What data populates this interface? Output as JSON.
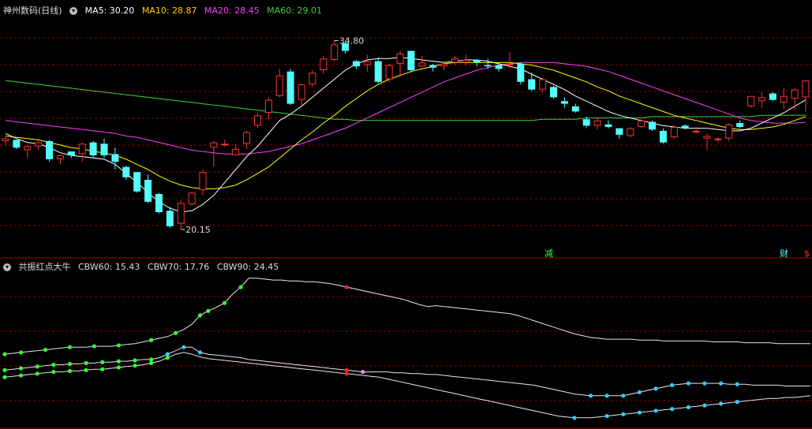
{
  "main_header": {
    "title": "神州数码(日线)",
    "indicators": [
      {
        "label": "MA5: 30.20",
        "color": "#ffffff"
      },
      {
        "label": "MA10: 28.87",
        "color": "#ffd000"
      },
      {
        "label": "MA20: 28.45",
        "color": "#ff40ff"
      },
      {
        "label": "MA60: 29.01",
        "color": "#40d040"
      }
    ]
  },
  "sub_header": {
    "title": "共振红点大牛",
    "indicators": [
      {
        "label": "CBW60: 15.43",
        "color": "#ffffff"
      },
      {
        "label": "CBW70: 17.76",
        "color": "#ffffff"
      },
      {
        "label": "CBW90: 24.45",
        "color": "#ffffff"
      }
    ]
  },
  "markers": {
    "jian": "减",
    "cai": "财",
    "dollar": "$"
  },
  "colors": {
    "up": "#ff3232",
    "down": "#54ffff",
    "grid": "#8b0000",
    "ma5": "#ffffff",
    "ma10": "#ffff00",
    "ma20": "#ff40ff",
    "ma60": "#40d040"
  },
  "chart_data": [
    {
      "type": "candlestick",
      "title": "神州数码(日线)",
      "ylim": [
        18.5,
        36.6
      ],
      "high_label": "34.80",
      "low_label": "20.15",
      "candles": [
        [
          27.0,
          27.3,
          26.7,
          27.2
        ],
        [
          27.1,
          27.1,
          26.4,
          26.5
        ],
        [
          26.3,
          26.7,
          25.7,
          26.6
        ],
        [
          26.6,
          27.0,
          26.3,
          26.9
        ],
        [
          27.0,
          27.1,
          25.4,
          25.6
        ],
        [
          25.6,
          25.9,
          25.2,
          25.9
        ],
        [
          26.2,
          26.2,
          25.7,
          25.9
        ],
        [
          26.0,
          26.9,
          25.4,
          26.8
        ],
        [
          26.9,
          27.0,
          25.7,
          25.9
        ],
        [
          26.8,
          27.2,
          25.7,
          25.9
        ],
        [
          26.0,
          26.5,
          24.8,
          25.4
        ],
        [
          25.0,
          25.1,
          24.0,
          24.2
        ],
        [
          24.6,
          24.6,
          23.0,
          23.1
        ],
        [
          24.0,
          24.4,
          22.2,
          22.3
        ],
        [
          22.9,
          23.0,
          21.4,
          21.5
        ],
        [
          21.6,
          21.9,
          20.3,
          20.4
        ],
        [
          20.6,
          22.4,
          20.15,
          22.2
        ],
        [
          22.1,
          23.1,
          22.0,
          23.0
        ],
        [
          23.2,
          24.8,
          22.8,
          24.6
        ],
        [
          26.5,
          27.0,
          25.0,
          26.9
        ],
        [
          26.8,
          27.1,
          26.6,
          26.8
        ],
        [
          25.9,
          26.8,
          25.9,
          26.4
        ],
        [
          26.8,
          27.8,
          26.4,
          27.7
        ],
        [
          28.2,
          29.2,
          28.0,
          29.0
        ],
        [
          29.2,
          30.4,
          28.7,
          30.2
        ],
        [
          30.5,
          32.6,
          30.4,
          32.1
        ],
        [
          32.4,
          32.6,
          29.8,
          29.9
        ],
        [
          30.2,
          31.5,
          29.8,
          31.4
        ],
        [
          31.4,
          32.5,
          31.2,
          32.3
        ],
        [
          32.5,
          33.6,
          32.2,
          33.4
        ],
        [
          33.3,
          34.8,
          33.2,
          34.5
        ],
        [
          34.6,
          34.7,
          33.8,
          34.0
        ],
        [
          33.2,
          33.3,
          32.6,
          32.8
        ],
        [
          32.9,
          33.7,
          32.4,
          33.2
        ],
        [
          33.2,
          33.5,
          31.5,
          31.6
        ],
        [
          31.8,
          33.0,
          31.6,
          32.9
        ],
        [
          33.0,
          34.0,
          32.0,
          33.8
        ],
        [
          34.0,
          34.0,
          32.3,
          32.5
        ],
        [
          32.8,
          33.6,
          32.8,
          33.1
        ],
        [
          32.9,
          33.0,
          32.4,
          32.7
        ],
        [
          32.8,
          33.2,
          32.5,
          33.0
        ],
        [
          33.1,
          33.6,
          32.9,
          33.4
        ],
        [
          33.1,
          33.7,
          32.9,
          33.3
        ],
        [
          33.3,
          33.3,
          32.8,
          33.1
        ],
        [
          32.9,
          33.4,
          32.6,
          32.8
        ],
        [
          32.9,
          32.9,
          32.4,
          32.6
        ],
        [
          32.9,
          33.9,
          32.6,
          33.0
        ],
        [
          33.0,
          33.1,
          31.4,
          31.6
        ],
        [
          31.8,
          32.3,
          30.9,
          31.0
        ],
        [
          31.0,
          31.9,
          30.8,
          31.8
        ],
        [
          31.2,
          31.3,
          30.3,
          30.4
        ],
        [
          30.1,
          30.4,
          29.6,
          29.9
        ],
        [
          29.7,
          29.9,
          29.2,
          29.3
        ],
        [
          28.7,
          28.9,
          28.0,
          28.2
        ],
        [
          28.2,
          28.8,
          27.9,
          28.6
        ],
        [
          28.3,
          28.6,
          28.0,
          28.1
        ],
        [
          28.0,
          28.0,
          27.2,
          27.5
        ],
        [
          27.4,
          28.1,
          27.3,
          28.0
        ],
        [
          28.1,
          28.7,
          28.0,
          28.6
        ],
        [
          28.5,
          28.6,
          27.8,
          27.9
        ],
        [
          27.8,
          28.0,
          26.8,
          26.9
        ],
        [
          27.3,
          28.2,
          27.2,
          28.1
        ],
        [
          28.2,
          28.3,
          27.9,
          28.0
        ],
        [
          27.8,
          28.1,
          27.6,
          27.8
        ],
        [
          27.2,
          27.6,
          26.3,
          27.4
        ],
        [
          27.1,
          27.3,
          26.9,
          27.2
        ],
        [
          27.2,
          28.4,
          27.0,
          28.3
        ],
        [
          28.4,
          28.6,
          28.0,
          28.1
        ],
        [
          29.7,
          30.5,
          29.6,
          30.5
        ],
        [
          30.1,
          30.8,
          29.6,
          30.4
        ],
        [
          30.7,
          30.8,
          30.1,
          30.2
        ],
        [
          30.0,
          31.1,
          29.5,
          30.5
        ],
        [
          30.3,
          31.1,
          29.4,
          31.0
        ],
        [
          30.4,
          31.7,
          29.3,
          31.7
        ]
      ],
      "ma": {
        "MA5": [
          27.6,
          27.2,
          26.9,
          26.8,
          26.5,
          26.1,
          25.9,
          25.8,
          25.7,
          25.6,
          25.2,
          24.5,
          23.8,
          23.0,
          22.3,
          21.8,
          21.5,
          21.6,
          22.1,
          22.8,
          23.8,
          24.8,
          25.8,
          26.6,
          27.6,
          28.6,
          29.1,
          29.7,
          30.4,
          31.1,
          31.8,
          32.5,
          33.0,
          33.3,
          33.4,
          33.4,
          33.5,
          33.4,
          33.3,
          33.2,
          33.1,
          33.2,
          33.3,
          33.3,
          33.2,
          33.0,
          32.8,
          32.6,
          32.2,
          31.8,
          31.4,
          31.0,
          30.5,
          30.1,
          29.7,
          29.3,
          29.0,
          28.8,
          28.6,
          28.4,
          28.2,
          28.1,
          28.0,
          28.0,
          28.0,
          27.9,
          27.8,
          27.8,
          28.0,
          28.4,
          28.8,
          29.2,
          29.7,
          30.2
        ],
        "MA10": [
          27.4,
          27.3,
          27.2,
          27.1,
          26.9,
          26.7,
          26.5,
          26.4,
          26.2,
          26.1,
          25.9,
          25.6,
          25.2,
          24.8,
          24.3,
          23.9,
          23.6,
          23.4,
          23.3,
          23.3,
          23.4,
          23.6,
          24.0,
          24.5,
          25.0,
          25.7,
          26.4,
          27.1,
          27.7,
          28.4,
          29.0,
          29.7,
          30.3,
          30.9,
          31.4,
          31.8,
          32.1,
          32.4,
          32.6,
          32.8,
          33.0,
          33.1,
          33.1,
          33.1,
          33.1,
          33.1,
          33.1,
          33.0,
          32.9,
          32.7,
          32.5,
          32.2,
          31.9,
          31.6,
          31.2,
          30.9,
          30.5,
          30.2,
          29.9,
          29.6,
          29.3,
          29.0,
          28.8,
          28.6,
          28.4,
          28.2,
          28.0,
          27.9,
          27.9,
          28.0,
          28.1,
          28.3,
          28.6,
          28.9
        ],
        "MA20": [
          28.6,
          28.5,
          28.4,
          28.3,
          28.2,
          28.1,
          28.0,
          27.9,
          27.8,
          27.7,
          27.6,
          27.4,
          27.3,
          27.1,
          26.9,
          26.7,
          26.5,
          26.3,
          26.2,
          26.1,
          26.0,
          26.0,
          26.0,
          26.1,
          26.2,
          26.4,
          26.6,
          26.8,
          27.1,
          27.4,
          27.7,
          28.0,
          28.4,
          28.8,
          29.2,
          29.6,
          30.0,
          30.4,
          30.8,
          31.2,
          31.6,
          31.9,
          32.2,
          32.5,
          32.7,
          32.9,
          33.0,
          33.1,
          33.1,
          33.1,
          33.1,
          33.0,
          32.9,
          32.8,
          32.6,
          32.4,
          32.1,
          31.8,
          31.5,
          31.2,
          30.9,
          30.6,
          30.3,
          30.0,
          29.7,
          29.4,
          29.1,
          28.8,
          28.6,
          28.5,
          28.4,
          28.4,
          28.4,
          28.45
        ],
        "MA60": [
          31.7,
          31.6,
          31.5,
          31.4,
          31.3,
          31.2,
          31.1,
          31.0,
          30.9,
          30.8,
          30.7,
          30.6,
          30.5,
          30.4,
          30.3,
          30.2,
          30.1,
          30.0,
          29.9,
          29.8,
          29.7,
          29.6,
          29.5,
          29.4,
          29.3,
          29.2,
          29.1,
          29.0,
          28.9,
          28.8,
          28.7,
          28.7,
          28.6,
          28.6,
          28.6,
          28.6,
          28.6,
          28.6,
          28.6,
          28.6,
          28.6,
          28.6,
          28.6,
          28.6,
          28.6,
          28.6,
          28.6,
          28.6,
          28.6,
          28.7,
          28.7,
          28.7,
          28.7,
          28.8,
          28.8,
          28.8,
          28.8,
          28.8,
          28.8,
          28.9,
          28.9,
          28.9,
          28.9,
          28.9,
          28.9,
          28.9,
          28.9,
          28.9,
          28.9,
          29.0,
          29.0,
          29.0,
          29.01,
          29.01
        ]
      }
    },
    {
      "type": "line",
      "title": "共振红点大牛",
      "ylim": [
        0,
        100
      ],
      "series": [
        {
          "name": "CBW60",
          "values": [
            12,
            13,
            14,
            15,
            16,
            17,
            18,
            19,
            20,
            20,
            20,
            21,
            21,
            21,
            22,
            23,
            24,
            26,
            28,
            30,
            32,
            36,
            40,
            46,
            56,
            61,
            65,
            70,
            80,
            88,
            98,
            98,
            97,
            96,
            96,
            95,
            95,
            94,
            94,
            93,
            92,
            90,
            88,
            86,
            84,
            82,
            80,
            78,
            76,
            74,
            71,
            68,
            66,
            67,
            66,
            65,
            64,
            63,
            62,
            61,
            60,
            59,
            58,
            56,
            53,
            50,
            47,
            44,
            41,
            38,
            35,
            33,
            31,
            30,
            29,
            29,
            29,
            29,
            28,
            28,
            28,
            27,
            27,
            27,
            27,
            27,
            27,
            26,
            26,
            26,
            26,
            25,
            25,
            25,
            25,
            24,
            24,
            24,
            24,
            24
          ]
        },
        {
          "name": "CBW70",
          "values": [
            -6,
            -5,
            -4,
            -3,
            -2,
            -1,
            0,
            0,
            1,
            1,
            2,
            2,
            3,
            3,
            4,
            4,
            5,
            6,
            6,
            8,
            12,
            16,
            20,
            20,
            14,
            12,
            11,
            10,
            9,
            8,
            6,
            5,
            4,
            3,
            2,
            1,
            0,
            -1,
            -2,
            -3,
            -4,
            -5,
            -6,
            -7,
            -8,
            -8,
            -8,
            -8,
            -9,
            -9,
            -10,
            -10,
            -11,
            -11,
            -12,
            -13,
            -14,
            -15,
            -16,
            -17,
            -18,
            -19,
            -20,
            -21,
            -22,
            -23,
            -25,
            -27,
            -29,
            -31,
            -33,
            -34,
            -35,
            -35,
            -35,
            -35,
            -35,
            -33,
            -31,
            -29,
            -27,
            -25,
            -23,
            -22,
            -21,
            -21,
            -21,
            -21,
            -21,
            -22,
            -22,
            -22,
            -23,
            -23,
            -23,
            -23,
            -24,
            -24,
            -24,
            -24
          ]
        },
        {
          "name": "CBW90",
          "values": [
            -14,
            -13,
            -12,
            -11,
            -10,
            -9,
            -8,
            -8,
            -7,
            -7,
            -6,
            -5,
            -5,
            -4,
            -3,
            -2,
            -1,
            0,
            2,
            4,
            8,
            12,
            14,
            12,
            9,
            7,
            6,
            5,
            4,
            3,
            2,
            1,
            0,
            -1,
            -2,
            -3,
            -4,
            -5,
            -6,
            -7,
            -8,
            -9,
            -10,
            -11,
            -12,
            -13,
            -14,
            -16,
            -18,
            -20,
            -22,
            -24,
            -26,
            -28,
            -30,
            -32,
            -34,
            -36,
            -38,
            -40,
            -42,
            -44,
            -46,
            -48,
            -50,
            -52,
            -54,
            -56,
            -58,
            -59,
            -60,
            -60,
            -60,
            -59,
            -58,
            -57,
            -56,
            -55,
            -54,
            -53,
            -52,
            -51,
            -50,
            -49,
            -48,
            -47,
            -46,
            -45,
            -44,
            -43,
            -42,
            -41,
            -40,
            -39,
            -38,
            -38,
            -37,
            -37,
            -36,
            -35
          ]
        }
      ],
      "dots": [
        {
          "series": "CBW60",
          "idx": [
            0,
            2,
            5,
            8,
            11,
            14,
            18
          ],
          "color": "#33ff33"
        },
        {
          "series": "CBW60",
          "idx": [
            21,
            24,
            25,
            27,
            29
          ],
          "color": "#33ff33"
        },
        {
          "series": "CBW60",
          "idx": [
            42
          ],
          "color": "#ff2020"
        },
        {
          "series": "CBW70",
          "idx": [
            0,
            2,
            4,
            6,
            8,
            10,
            12,
            14,
            16,
            18
          ],
          "color": "#33ff33"
        },
        {
          "series": "CBW70",
          "idx": [
            20,
            22,
            24
          ],
          "color": "#33ccff"
        },
        {
          "series": "CBW70",
          "idx": [
            42
          ],
          "color": "#ff2020"
        },
        {
          "series": "CBW70",
          "idx": [
            44
          ],
          "color": "#ff88ff"
        },
        {
          "series": "CBW70",
          "idx": [
            72,
            74,
            76,
            78,
            80,
            82,
            84,
            86,
            88,
            90
          ],
          "color": "#33ccff"
        },
        {
          "series": "CBW90",
          "idx": [
            0,
            2,
            4,
            6,
            8,
            10,
            12,
            14,
            16,
            18,
            20
          ],
          "color": "#33ff33"
        },
        {
          "series": "CBW90",
          "idx": [
            42
          ],
          "color": "#ff2020"
        },
        {
          "series": "CBW90",
          "idx": [
            70,
            74,
            76,
            78,
            80,
            82,
            84,
            86,
            88,
            90
          ],
          "color": "#33ccff"
        }
      ]
    }
  ]
}
